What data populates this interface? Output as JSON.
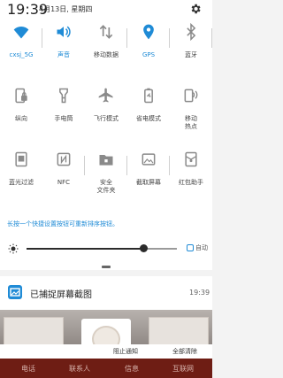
{
  "status_bar": {
    "time": "19:39",
    "date": "4月13日, 星期四"
  },
  "tiles": [
    {
      "label": "cxsj_5G",
      "icon": "wifi-icon",
      "on": true,
      "toggle": true
    },
    {
      "label": "声音",
      "icon": "speaker-icon",
      "on": true,
      "toggle": false
    },
    {
      "label": "移动数据",
      "icon": "mobile-data-icon",
      "on": false,
      "toggle": true
    },
    {
      "label": "GPS",
      "icon": "location-pin-icon",
      "on": true,
      "toggle": true
    },
    {
      "label": "蓝牙",
      "icon": "bluetooth-icon",
      "on": false,
      "toggle": true
    },
    {
      "label": "纵向",
      "icon": "portrait-lock-icon",
      "on": false,
      "toggle": false
    },
    {
      "label": "手电筒",
      "icon": "flashlight-icon",
      "on": false,
      "toggle": false
    },
    {
      "label": "飞行模式",
      "icon": "airplane-icon",
      "on": false,
      "toggle": false
    },
    {
      "label": "省电模式",
      "icon": "battery-saver-icon",
      "on": false,
      "toggle": false
    },
    {
      "label": "移动\n热点",
      "icon": "hotspot-icon",
      "on": false,
      "toggle": false
    },
    {
      "label": "蓝光过滤",
      "icon": "blue-light-filter-icon",
      "on": false,
      "toggle": false
    },
    {
      "label": "NFC",
      "icon": "nfc-icon",
      "on": false,
      "toggle": true
    },
    {
      "label": "安全\n文件夹",
      "icon": "secure-folder-icon",
      "on": false,
      "toggle": true
    },
    {
      "label": "截取屏幕",
      "icon": "screenshot-icon",
      "on": false,
      "toggle": true
    },
    {
      "label": "红包助手",
      "icon": "red-envelope-icon",
      "on": false,
      "toggle": false
    }
  ],
  "hint_text": "长按一个快捷设置按钮可重新排序按钮。",
  "brightness": {
    "level": 0.78,
    "auto_label": "自动"
  },
  "notification": {
    "title": "已捕捉屏幕截图",
    "time": "19:39"
  },
  "actions": {
    "block": "阻止通知",
    "clear": "全部清除"
  },
  "dock": [
    "电话",
    "联系人",
    "信息",
    "互联网"
  ],
  "colors": {
    "accent": "#1f8bd6",
    "icon_off": "#8a8a8a"
  }
}
